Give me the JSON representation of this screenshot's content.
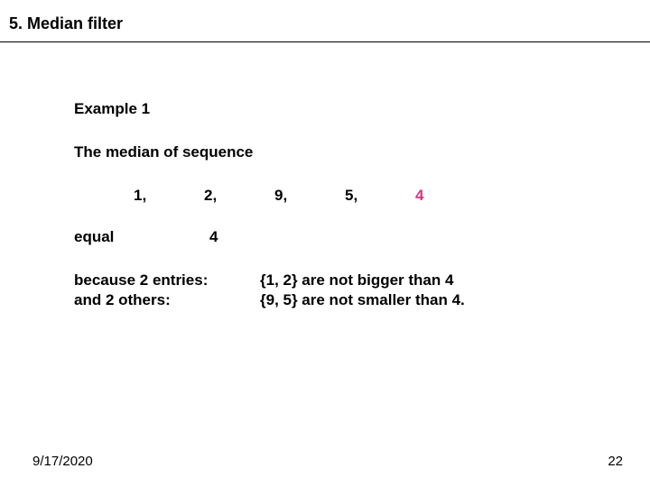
{
  "title": "5. Median filter",
  "example_label": "Example 1",
  "intro": "The median of sequence",
  "sequence": [
    "1,",
    "2,",
    "9,",
    "5,",
    "4"
  ],
  "highlight_index": 4,
  "equal_label": "equal",
  "equal_value": "4",
  "because_lines_left": [
    "because 2 entries:",
    "and  2 others:"
  ],
  "because_lines_right": [
    "{1, 2}  are not bigger than  4",
    "{9, 5} are not smaller than 4."
  ],
  "footer_date": "9/17/2020",
  "footer_page": "22"
}
